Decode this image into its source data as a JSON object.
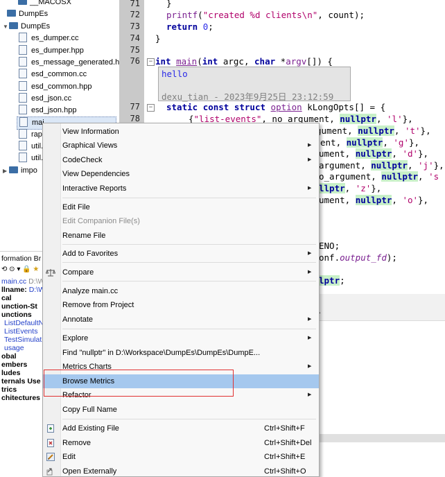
{
  "tree": {
    "items": [
      {
        "label": "__MACOSX"
      },
      {
        "label": "DumpEs"
      },
      {
        "label": "DumpEs"
      },
      {
        "label": "es_dumper.cc"
      },
      {
        "label": "es_dumper.hpp"
      },
      {
        "label": "es_message_generated.h"
      },
      {
        "label": "esd_common.cc"
      },
      {
        "label": "esd_common.hpp"
      },
      {
        "label": "esd_json.cc"
      },
      {
        "label": "esd_json.hpp"
      },
      {
        "label": "mai"
      },
      {
        "label": "rapi"
      },
      {
        "label": "util.c"
      },
      {
        "label": "util.h"
      },
      {
        "label": "impo"
      }
    ]
  },
  "info_panel": {
    "header": "formation Br",
    "file": "main.cc",
    "file_suffix": "D:\\W",
    "fullname_label": "llname:",
    "fullname_value": "D:\\W",
    "rows": [
      "cal",
      "unction-St",
      "unctions",
      "ListDefaultN",
      "ListEvents",
      "TestSimulat",
      "usage",
      "obal",
      "embers",
      "ludes",
      "ternals Use",
      "trics",
      "chitectures"
    ]
  },
  "editor": {
    "lines": [
      {
        "n": "71"
      },
      {
        "n": "72"
      },
      {
        "n": "73"
      },
      {
        "n": "74"
      },
      {
        "n": "75"
      },
      {
        "n": "76"
      },
      {
        "n": "77"
      },
      {
        "n": "78"
      }
    ],
    "tokens": {
      "brace_close": "}",
      "printf": "printf",
      "open_paren": "(",
      "str_created": "\"created %d clients\\n\"",
      "comma_count": ", count);",
      "return_kw": "return",
      "zero": "0",
      "semicolon": ";",
      "int_kw": "int",
      "main_fn": "main",
      "main_params_a": "(",
      "int_kw2": "int",
      "argc": " argc, ",
      "char_kw": "char",
      "argv": " *",
      "argv_name": "argv",
      "main_params_b": "[]) {",
      "static_kw": "static",
      "const_kw": "const",
      "struct_kw": "struct",
      "option_type": "option",
      "klong": " kLongOpts[] = {",
      "open_brace": "{",
      "str_list_events": "\"list-events\"",
      "no_argument": ", no_argument, ",
      "nullptr": "nullptr",
      "comma_sp": ", ",
      "str_l": "'l'",
      "close_brace_comma": "},",
      "frag_gument": "gument, ",
      "str_t": "'t'",
      "frag_ent": "ent, ",
      "str_g": "'g'",
      "frag_ument": "ument, ",
      "str_d": "'d'",
      "frag_argument": "argument, ",
      "str_j": "'j'",
      "frag_oargument": "o_argument, ",
      "str_s": "'s",
      "frag_llptr": "llptr",
      "str_z": "'z'",
      "str_o": "'o'",
      "frag_eno": "ENO;",
      "frag_onf": "onf.",
      "output_fd": "output_fd",
      "frag_close": ");",
      "frag_lptr": "lptr",
      "frag_semicolon": ";",
      "frag_lower_symbol": ">"
    },
    "note": {
      "text": "hello",
      "meta": "dexu_tian - 2023年9月25日 23:12:59"
    }
  },
  "context_menu": {
    "items": [
      {
        "label": "View Information"
      },
      {
        "label": "Graphical Views",
        "arrow": "▶"
      },
      {
        "label": "CodeCheck",
        "arrow": "▶"
      },
      {
        "label": "View Dependencies"
      },
      {
        "label": "Interactive Reports",
        "arrow": "▶"
      },
      {
        "label": "Edit File"
      },
      {
        "label": "Edit Companion File(s)"
      },
      {
        "label": "Rename File"
      },
      {
        "label": "Add to Favorites",
        "arrow": "▶"
      },
      {
        "label": "Compare",
        "arrow": "▶"
      },
      {
        "label": "Analyze main.cc"
      },
      {
        "label": "Remove from Project"
      },
      {
        "label": "Annotate",
        "arrow": "▶"
      },
      {
        "label": "Explore",
        "arrow": "▶"
      },
      {
        "label": "Find \"nullptr\" in D:\\Workspace\\DumpEs\\DumpEs\\DumpE..."
      },
      {
        "label": "Metrics Charts",
        "arrow": "▶"
      },
      {
        "label": "Browse Metrics"
      },
      {
        "label": "Refactor",
        "arrow": "▶"
      },
      {
        "label": "Copy Full Name"
      },
      {
        "label": "Add Existing File",
        "shortcut": "Ctrl+Shift+F"
      },
      {
        "label": "Remove",
        "shortcut": "Ctrl+Shift+Del"
      },
      {
        "label": "Edit",
        "shortcut": "Ctrl+Shift+E"
      },
      {
        "label": "Open Externally",
        "shortcut": "Ctrl+Shift+O"
      }
    ]
  }
}
